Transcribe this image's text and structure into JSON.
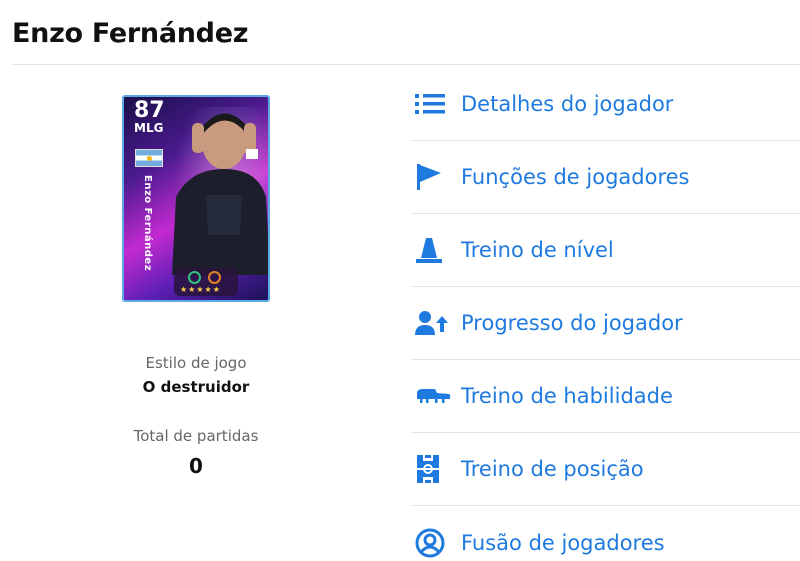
{
  "page": {
    "title": "Enzo Fernández"
  },
  "card": {
    "rating": "87",
    "position": "MLG",
    "name": "Enzo Fernández",
    "nationality_flag": "argentina-flag",
    "accent_color": "#5fa8e6"
  },
  "profile": {
    "play_style_label": "Estilo de jogo",
    "play_style_value": "O destruidor",
    "matches_label": "Total de partidas",
    "matches_value": "0"
  },
  "menu": {
    "link_color": "#1f7ae0",
    "items": [
      {
        "label": "Detalhes do jogador",
        "icon": "list-icon"
      },
      {
        "label": "Funções de jogadores",
        "icon": "flag-icon"
      },
      {
        "label": "Treino de nível",
        "icon": "cone-icon"
      },
      {
        "label": "Progresso do jogador",
        "icon": "person-up-icon"
      },
      {
        "label": "Treino de habilidade",
        "icon": "boot-icon"
      },
      {
        "label": "Treino de posição",
        "icon": "pitch-icon"
      },
      {
        "label": "Fusão de jogadores",
        "icon": "person-circle-icon"
      }
    ]
  }
}
